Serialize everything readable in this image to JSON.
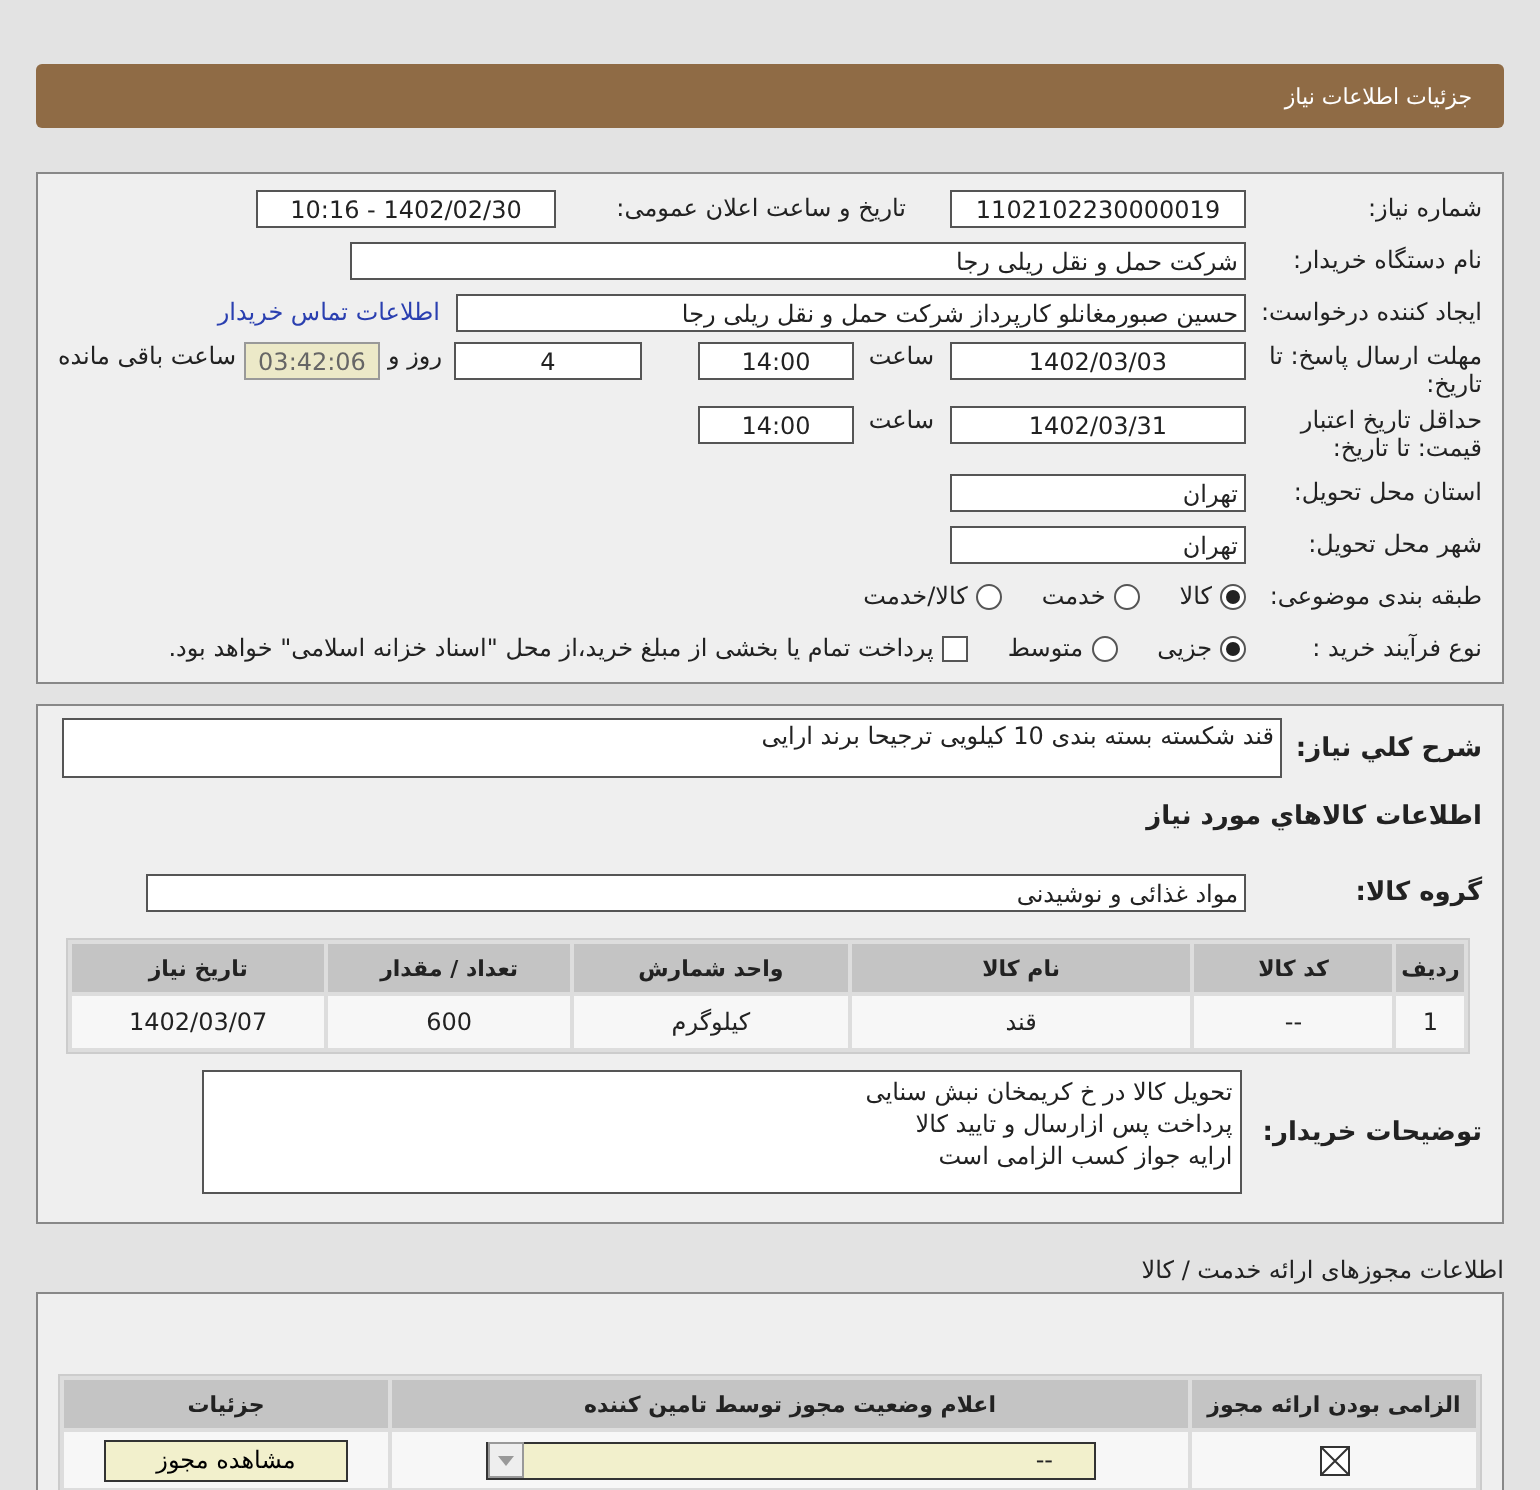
{
  "header": {
    "title": "جزئیات اطلاعات نیاز"
  },
  "need": {
    "number": {
      "label": "شماره نیاز:",
      "value": "1102102230000019"
    },
    "announce": {
      "label": "تاریخ و ساعت اعلان عمومی:",
      "value": "1402/02/30 - 10:16"
    },
    "buyer": {
      "label": "نام دستگاه خریدار:",
      "value": "شرکت حمل و نقل ریلی رجا"
    },
    "requester": {
      "label": "ایجاد کننده درخواست:",
      "value": "حسین صبورمغانلو کارپرداز شرکت حمل و نقل ریلی رجا",
      "link": "اطلاعات تماس خریدار"
    },
    "deadline": {
      "label": "مهلت ارسال پاسخ: تا تاریخ:",
      "date": "1402/03/03",
      "time_label": "ساعت",
      "time": "14:00",
      "days": "4",
      "days_label": "روز و",
      "remaining": "03:42:06",
      "remaining_label": "ساعت باقی مانده"
    },
    "validity": {
      "label": "حداقل تاریخ اعتبار قیمت: تا تاریخ:",
      "date": "1402/03/31",
      "time_label": "ساعت",
      "time": "14:00"
    },
    "province": {
      "label": "استان محل تحویل:",
      "value": "تهران"
    },
    "city": {
      "label": "شهر محل تحویل:",
      "value": "تهران"
    },
    "category": {
      "label": "طبقه بندی موضوعی:",
      "options": [
        {
          "label": "کالا",
          "selected": true
        },
        {
          "label": "خدمت",
          "selected": false
        },
        {
          "label": "کالا/خدمت",
          "selected": false
        }
      ]
    },
    "process": {
      "label": "نوع فرآیند خرید :",
      "options": [
        {
          "label": "جزیی",
          "selected": true
        },
        {
          "label": "متوسط",
          "selected": false
        }
      ],
      "payment": {
        "label": "پرداخت تمام یا بخشی از مبلغ خرید،از محل \"اسناد خزانه اسلامی\" خواهد بود.",
        "checked": false
      }
    }
  },
  "goods": {
    "description": {
      "label": "شرح کلي نياز:",
      "value": "قند شکسته بسته بندی 10 کیلویی ترجیحا برند ارایی"
    },
    "title": "اطلاعات كالاهاي مورد نياز",
    "group": {
      "label": "گروه کالا:",
      "value": "مواد غذائی و نوشیدنی"
    },
    "table": {
      "columns": [
        "ردیف",
        "کد کالا",
        "نام کالا",
        "واحد شمارش",
        "تعداد / مقدار",
        "تاریخ نیاز"
      ],
      "rows": [
        [
          "1",
          "--",
          "قند",
          "کیلوگرم",
          "600",
          "1402/03/07"
        ]
      ]
    },
    "notes": {
      "label": "توضیحات خریدار:",
      "lines": [
        "تحویل کالا در خ کریمخان نبش سنایی",
        "پرداخت پس ازارسال و تایید کالا",
        "ارایه  جواز کسب الزامی است"
      ]
    }
  },
  "permits": {
    "title": "اطلاعات مجوزهای ارائه خدمت / کالا",
    "columns": [
      "الزامی بودن ارائه مجوز",
      "اعلام وضعیت مجوز توسط تامین کننده",
      "جزئیات"
    ],
    "rows": [
      {
        "required": true,
        "status": "--",
        "button": "مشاهده مجوز"
      }
    ]
  }
}
